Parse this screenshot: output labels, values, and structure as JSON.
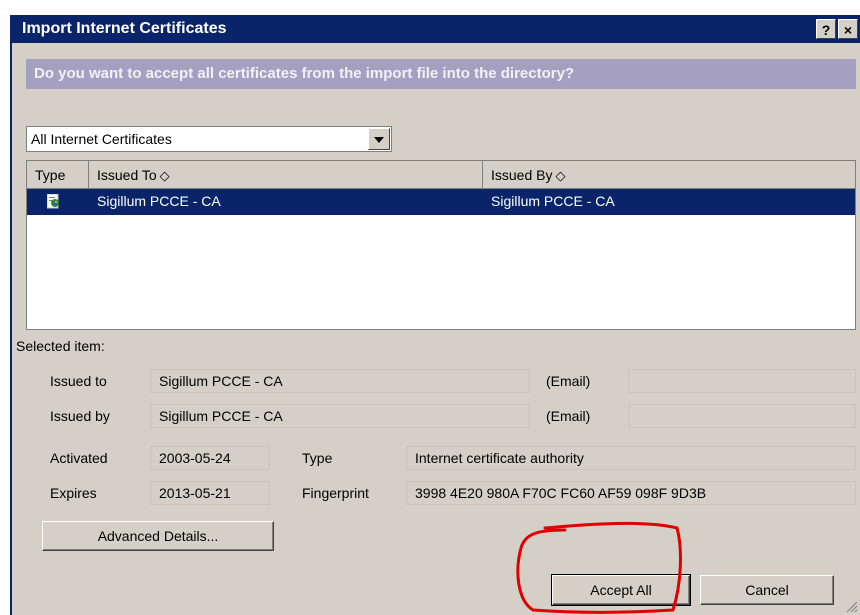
{
  "window": {
    "title": "Import Internet Certificates",
    "help_glyph": "?",
    "close_glyph": "×"
  },
  "question": "Do you want to accept all certificates from the import file into the directory?",
  "filter": {
    "selected": "All Internet Certificates"
  },
  "list": {
    "columns": {
      "type": "Type",
      "issued_to": "Issued To",
      "issued_by": "Issued By",
      "sort_glyph": "◇"
    },
    "rows": [
      {
        "icon": "certificate-icon",
        "issued_to": "Sigillum PCCE - CA",
        "issued_by": "Sigillum PCCE - CA"
      }
    ]
  },
  "details": {
    "section_label": "Selected item:",
    "issued_to_label": "Issued to",
    "issued_to_value": "Sigillum PCCE - CA",
    "issued_to_email_label": "(Email)",
    "issued_to_email_value": "",
    "issued_by_label": "Issued by",
    "issued_by_value": "Sigillum PCCE - CA",
    "issued_by_email_label": "(Email)",
    "issued_by_email_value": "",
    "activated_label": "Activated",
    "activated_value": "2003-05-24",
    "expires_label": "Expires",
    "expires_value": "2013-05-21",
    "type_label": "Type",
    "type_value": "Internet certificate authority",
    "fingerprint_label": "Fingerprint",
    "fingerprint_value": "3998 4E20 980A F70C FC60 AF59 098F 9D3B"
  },
  "buttons": {
    "advanced": "Advanced Details...",
    "accept_all": "Accept All",
    "cancel": "Cancel"
  },
  "colors": {
    "titlebar": "#0a246a",
    "selection": "#0a246a",
    "annotation": "#e00000",
    "dialog_bg": "#d4d0c8"
  }
}
